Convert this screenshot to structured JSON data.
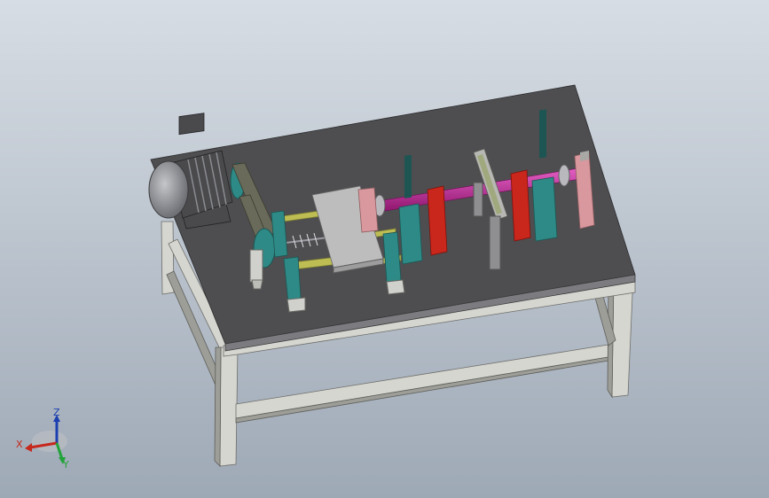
{
  "view": {
    "background_top": "#d7dde4",
    "background_bottom": "#9ea9b6"
  },
  "colors": {
    "table_top": "#4e4e50",
    "table_edge": "#7c7c80",
    "frame": "#d6d6d0",
    "frame_shadow": "#9e9e98",
    "motor": "#4a4a4d",
    "motor_cap": "#8d8f93",
    "shaft": "#c2259a",
    "link": "#b7b8b4",
    "rod": "#bdbd54",
    "bearing_teal": "#2e8a86",
    "block_red": "#c9261c",
    "plate_grey": "#bdbdbd",
    "pink_block": "#d8989d",
    "belt": "#6a6a5a"
  },
  "triad": {
    "icon": "coordinate-axes-triad",
    "x_label": "X",
    "y_label": "Y",
    "z_label": "Z",
    "x_color": "#c6281c",
    "y_color": "#22a33a",
    "z_color": "#1b3fb0"
  }
}
